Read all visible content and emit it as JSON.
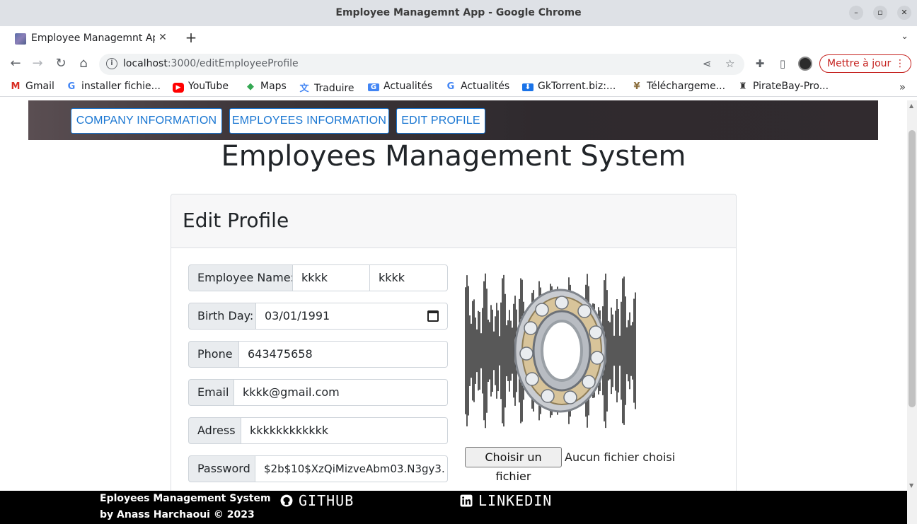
{
  "window": {
    "title": "Employee Managemnt App - Google Chrome",
    "tab_title": "Employee Managemnt App",
    "url_host": "localhost",
    "url_path": ":3000/editEmployeeProfile",
    "update_label": "Mettre à jour"
  },
  "bookmarks": [
    {
      "label": "Gmail",
      "icon": "gmail-icon"
    },
    {
      "label": "installer fichie...",
      "icon": "google-icon"
    },
    {
      "label": "YouTube",
      "icon": "youtube-icon"
    },
    {
      "label": "Maps",
      "icon": "maps-icon"
    },
    {
      "label": "Traduire",
      "icon": "translate-icon"
    },
    {
      "label": "Actualités",
      "icon": "news-icon"
    },
    {
      "label": "Actualités",
      "icon": "google-icon"
    },
    {
      "label": "GkTorrent.biz:...",
      "icon": "download-icon"
    },
    {
      "label": "Téléchargeme...",
      "icon": "download-icon"
    },
    {
      "label": "PirateBay-Pro...",
      "icon": "pirate-icon"
    }
  ],
  "nav": {
    "company": "COMPANY INFORMATION",
    "employees": "EMPLOYEES INFORMATION",
    "edit_profile": "EDIT PROFILE"
  },
  "page": {
    "title": "Employees Management System",
    "card_title": "Edit Profile"
  },
  "form": {
    "name_label": "Employee Name:",
    "first_name": "kkkk",
    "last_name": "kkkk",
    "birth_label": "Birth Day:",
    "birth_value": "03/01/1991",
    "phone_label": "Phone",
    "phone_value": "643475658",
    "email_label": "Email",
    "email_value": "kkkk@gmail.com",
    "address_label": "Adress",
    "address_value": "kkkkkkkkkkkk",
    "password_label": "Password",
    "password_value": "$2b$10$XzQiMizveAbm03.N3gy3.",
    "file_button": "Choisir un fichier",
    "file_status": "Aucun fichier choisi"
  },
  "footer": {
    "line1": "Eployees Management System",
    "line2": "by Anass Harchaoui © 2023",
    "github": "GITHUB",
    "linkedin": "LINKEDIN"
  }
}
